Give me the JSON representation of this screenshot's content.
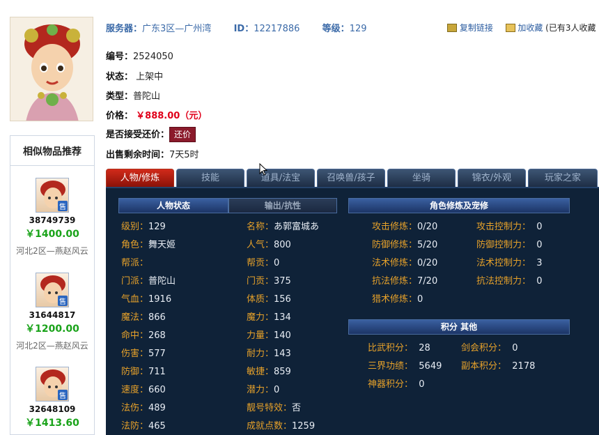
{
  "header": {
    "server_label": "服务器：",
    "server_value": "广东3区—广州湾",
    "id_label": "ID：",
    "id_value": "12217886",
    "level_label": "等级：",
    "level_value": "129",
    "copy_link": "复制链接",
    "favorite": "加收藏",
    "favorite_count": "(已有3人收藏"
  },
  "info": {
    "number_label": "编号：",
    "number_value": "2524050",
    "status_label": "状态：",
    "status_value": "上架中",
    "type_label": "类型：",
    "type_value": "普陀山",
    "price_label": "价格：",
    "price_value": "￥888.00（元）",
    "bargain_label": "是否接受还价：",
    "bargain_button": "还价",
    "remaining_label": "出售剩余时间：",
    "remaining_value": "7天5时"
  },
  "sidebar": {
    "title": "相似物品推荐",
    "items": [
      {
        "id": "38749739",
        "price": "￥1400.00",
        "server": "河北2区—燕赵风云",
        "badge": "售"
      },
      {
        "id": "31644817",
        "price": "￥1200.00",
        "server": "河北2区—燕赵风云",
        "badge": "售"
      },
      {
        "id": "32648109",
        "price": "￥1413.60",
        "server": "",
        "badge": "售"
      }
    ]
  },
  "tabs": [
    "人物/修炼",
    "技能",
    "道具/法宝",
    "召唤兽/孩子",
    "坐骑",
    "锦衣/外观",
    "玩家之家"
  ],
  "panel": {
    "left_tab_active": "人物状态",
    "left_tab_inactive": "输出/抗性",
    "cultivation_title": "角色修炼及宠修",
    "score_title": "积分 其他",
    "col1": [
      {
        "label": "级别：",
        "value": "129"
      },
      {
        "label": "角色：",
        "value": "舞天姬"
      },
      {
        "label": "帮派：",
        "value": ""
      },
      {
        "label": "门派：",
        "value": "普陀山"
      },
      {
        "label": "气血：",
        "value": "1916"
      },
      {
        "label": "魔法：",
        "value": "866"
      },
      {
        "label": "命中：",
        "value": "268"
      },
      {
        "label": "伤害：",
        "value": "577"
      },
      {
        "label": "防御：",
        "value": "711"
      },
      {
        "label": "速度：",
        "value": "660"
      },
      {
        "label": "法伤：",
        "value": "489"
      },
      {
        "label": "法防：",
        "value": "465"
      }
    ],
    "col2": [
      {
        "label": "名称：",
        "value": "あ郭富城あ"
      },
      {
        "label": "人气：",
        "value": "800"
      },
      {
        "label": "帮贡：",
        "value": "0"
      },
      {
        "label": "门贡：",
        "value": "375"
      },
      {
        "label": "体质：",
        "value": "156"
      },
      {
        "label": "魔力：",
        "value": "134"
      },
      {
        "label": "力量：",
        "value": "140"
      },
      {
        "label": "耐力：",
        "value": "143"
      },
      {
        "label": "敏捷：",
        "value": "859"
      },
      {
        "label": "潜力：",
        "value": "0"
      },
      {
        "label": "靓号特效：",
        "value": "否"
      },
      {
        "label": "成就点数：",
        "value": "1259"
      }
    ],
    "col3": [
      {
        "label": "攻击修炼：",
        "value": "0/20"
      },
      {
        "label": "防御修炼：",
        "value": "5/20"
      },
      {
        "label": "法术修炼：",
        "value": "0/20"
      },
      {
        "label": "抗法修炼：",
        "value": "7/20"
      },
      {
        "label": "猎术修炼：",
        "value": "0"
      }
    ],
    "col4": [
      {
        "label": "攻击控制力：",
        "value": "0"
      },
      {
        "label": "防御控制力：",
        "value": "0"
      },
      {
        "label": "法术控制力：",
        "value": "3"
      },
      {
        "label": "抗法控制力：",
        "value": "0"
      }
    ],
    "score_col1": [
      {
        "label": "比武积分：",
        "value": "28"
      },
      {
        "label": "三界功绩：",
        "value": "5649"
      },
      {
        "label": "神器积分：",
        "value": "0"
      }
    ],
    "score_col2": [
      {
        "label": "剑会积分：",
        "value": "0"
      },
      {
        "label": "副本积分：",
        "value": "2178"
      }
    ]
  }
}
